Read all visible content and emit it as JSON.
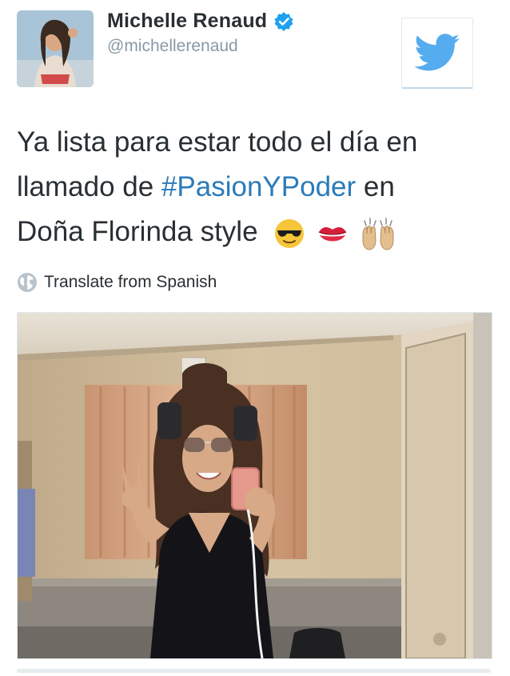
{
  "user": {
    "name": "Michelle Renaud",
    "handle": "@michellerenaud",
    "verified": true
  },
  "tweet": {
    "lines": [
      {
        "before": "Ya lista para estar todo el día en",
        "hashtag": "",
        "after": ""
      },
      {
        "before": "llamado de ",
        "hashtag": "#PasionYPoder",
        "after": "  en"
      },
      {
        "before": "Doña Florinda style",
        "hashtag": "",
        "after": ""
      }
    ],
    "emojis": [
      "sunglasses-face-icon",
      "kiss-mark-icon",
      "raised-hands-icon"
    ]
  },
  "translate": {
    "label": "Translate from Spanish",
    "icon": "globe-icon"
  },
  "colors": {
    "twitter_blue": "#55acee",
    "verified_blue": "#1da1f2",
    "hashtag": "#2b7bb9",
    "secondary_text": "#8899a6"
  }
}
